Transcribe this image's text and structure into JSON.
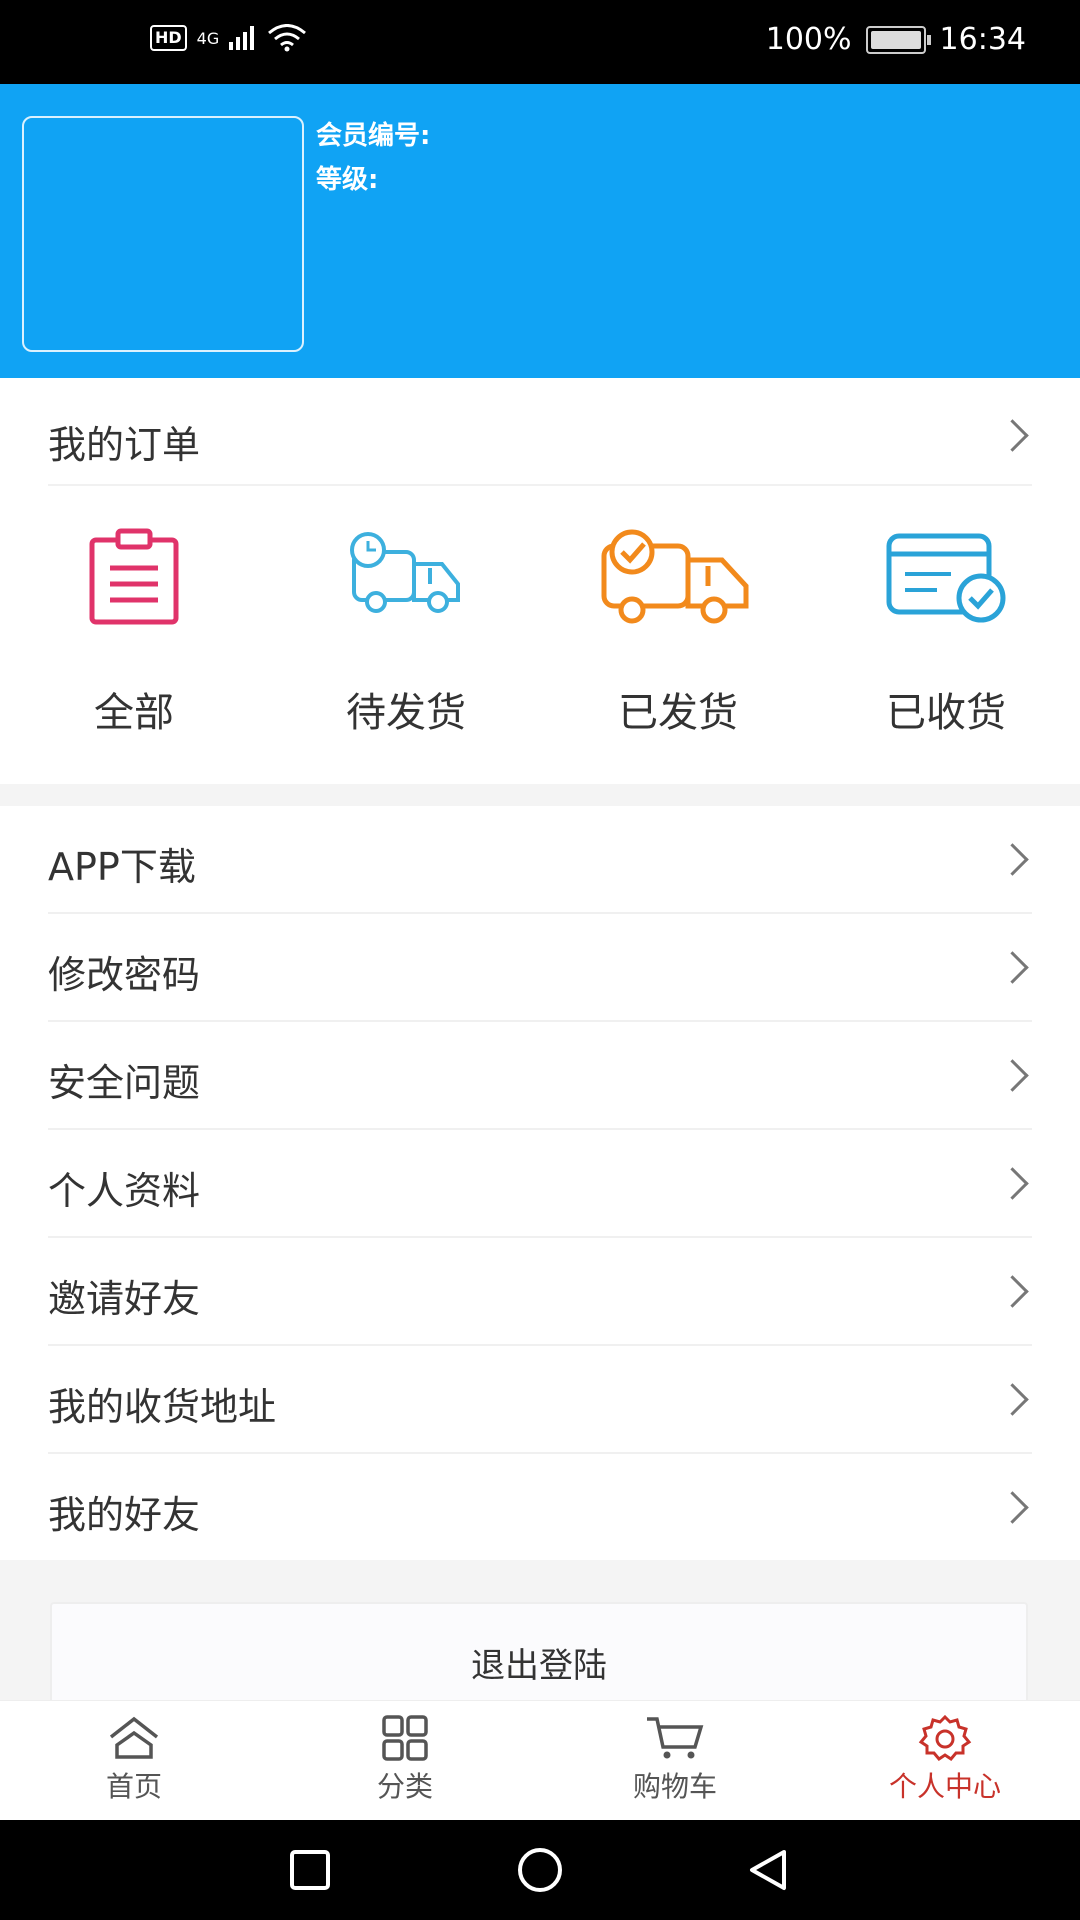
{
  "status_bar": {
    "hd": "HD",
    "network": "4G",
    "battery_percent": "100%",
    "time": "16:34"
  },
  "header": {
    "member_no_label": "会员编号:",
    "level_label": "等级:"
  },
  "orders": {
    "title": "我的订单",
    "items": [
      {
        "label": "全部",
        "icon": "clipboard-icon",
        "color": "#e0336a"
      },
      {
        "label": "待发货",
        "icon": "truck-clock-icon",
        "color": "#3db0de"
      },
      {
        "label": "已发货",
        "icon": "truck-check-icon",
        "color": "#f28a1c"
      },
      {
        "label": "已收货",
        "icon": "card-check-icon",
        "color": "#2aa3d8"
      }
    ]
  },
  "menu": {
    "items": [
      {
        "label": "APP下载"
      },
      {
        "label": "修改密码"
      },
      {
        "label": "安全问题"
      },
      {
        "label": "个人资料"
      },
      {
        "label": "邀请好友"
      },
      {
        "label": "我的收货地址"
      },
      {
        "label": "我的好友"
      }
    ]
  },
  "logout_label": "退出登陆",
  "tabbar": {
    "items": [
      {
        "label": "首页",
        "icon": "home-icon",
        "active": false
      },
      {
        "label": "分类",
        "icon": "grid-icon",
        "active": false
      },
      {
        "label": "购物车",
        "icon": "cart-icon",
        "active": false
      },
      {
        "label": "个人中心",
        "icon": "gear-icon",
        "active": true
      }
    ],
    "active_color": "#c8322a"
  },
  "colors": {
    "header_bg": "#10a3f4"
  }
}
